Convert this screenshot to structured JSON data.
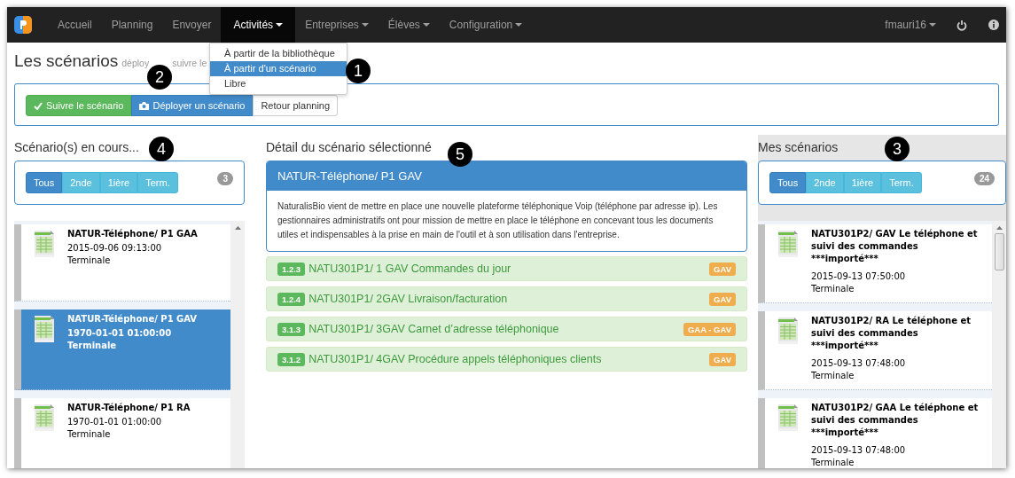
{
  "navbar": {
    "items": [
      {
        "label": "Accueil",
        "dropdown": false,
        "selected": false
      },
      {
        "label": "Planning",
        "dropdown": false,
        "selected": false
      },
      {
        "label": "Envoyer",
        "dropdown": false,
        "selected": false
      },
      {
        "label": "Activités",
        "dropdown": true,
        "selected": true
      },
      {
        "label": "Entreprises",
        "dropdown": true,
        "selected": false
      },
      {
        "label": "Élèves",
        "dropdown": true,
        "selected": false
      },
      {
        "label": "Configuration",
        "dropdown": true,
        "selected": false
      }
    ],
    "user": "fmauri16"
  },
  "activities_menu": {
    "callout": "1",
    "items": [
      {
        "label": "À partir de la bibliothèque",
        "selected": false
      },
      {
        "label": "À partir d'un scénario",
        "selected": true
      },
      {
        "label": "Libre",
        "selected": false
      }
    ]
  },
  "page": {
    "title": "Les scénarios",
    "subtitle_parts": [
      "déploy",
      "suivre le"
    ],
    "callout": "2"
  },
  "actions": [
    {
      "label": "Suivre le scénario",
      "kind": "success"
    },
    {
      "label": "Déployer un scénario",
      "kind": "primary"
    },
    {
      "label": "Retour planning",
      "kind": "default"
    }
  ],
  "in_progress": {
    "title": "Scénario(s) en cours...",
    "callout": "4",
    "count": "3",
    "filters": [
      {
        "label": "Tous",
        "selected": true
      },
      {
        "label": "2nde",
        "selected": false
      },
      {
        "label": "1ière",
        "selected": false
      },
      {
        "label": "Term.",
        "selected": false
      }
    ],
    "items": [
      {
        "name": "NATUR-Téléphone/ P1 GAA",
        "date": "2015-09-06 09:13:00",
        "level": "Terminale",
        "selected": false
      },
      {
        "name": "NATUR-Téléphone/ P1 GAV",
        "date": "1970-01-01 01:00:00",
        "level": "Terminale",
        "selected": true
      },
      {
        "name": "NATUR-Téléphone/ P1 RA",
        "date": "1970-01-01 01:00:00",
        "level": "Terminale",
        "selected": false
      }
    ]
  },
  "detail": {
    "title": "Détail du scénario sélectionné",
    "callout": "5",
    "name": "NATUR-Téléphone/ P1 GAV",
    "description": "NaturalisBio vient de mettre en place une nouvelle plateforme téléphonique Voip (téléphone par adresse ip). Les gestionnaires administratifs ont pour mission de mettre en place le téléphone en concevant tous les documents utiles et indispensables à la prise en main de l'outil et à son utilisation dans l'entreprise.",
    "activities": [
      {
        "code": "1.2.3",
        "label": "NATU301P1/ 1 GAV Commandes du jour",
        "tag": "GAV"
      },
      {
        "code": "1.2.4",
        "label": "NATU301P1/ 2GAV Livraison/facturation",
        "tag": "GAV"
      },
      {
        "code": "3.1.3",
        "label": "NATU301P1/ 3GAV Carnet d’adresse téléphonique",
        "tag": "GAA - GAV"
      },
      {
        "code": "3.1.2",
        "label": "NATU301P1/ 4GAV Procédure appels téléphoniques clients",
        "tag": "GAV"
      }
    ]
  },
  "mine": {
    "title": "Mes scénarios",
    "callout": "3",
    "count": "24",
    "filters": [
      {
        "label": "Tous",
        "selected": true
      },
      {
        "label": "2nde",
        "selected": false
      },
      {
        "label": "1ière",
        "selected": false
      },
      {
        "label": "Term.",
        "selected": false
      }
    ],
    "items": [
      {
        "name": "NATU301P2/ GAV Le téléphone et suivi des commandes ***importé***",
        "date": "2015-09-13 07:50:00",
        "level": "Terminale",
        "selected": false
      },
      {
        "name": "NATU301P2/ RA Le téléphone et suivi des commandes ***importé***",
        "date": "2015-09-13 07:48:00",
        "level": "Terminale",
        "selected": false
      },
      {
        "name": "NATU301P2/ GAA Le téléphone et suivi des commandes ***importé***",
        "date": "2015-09-13 07:48:00",
        "level": "Terminale",
        "selected": false
      }
    ]
  }
}
